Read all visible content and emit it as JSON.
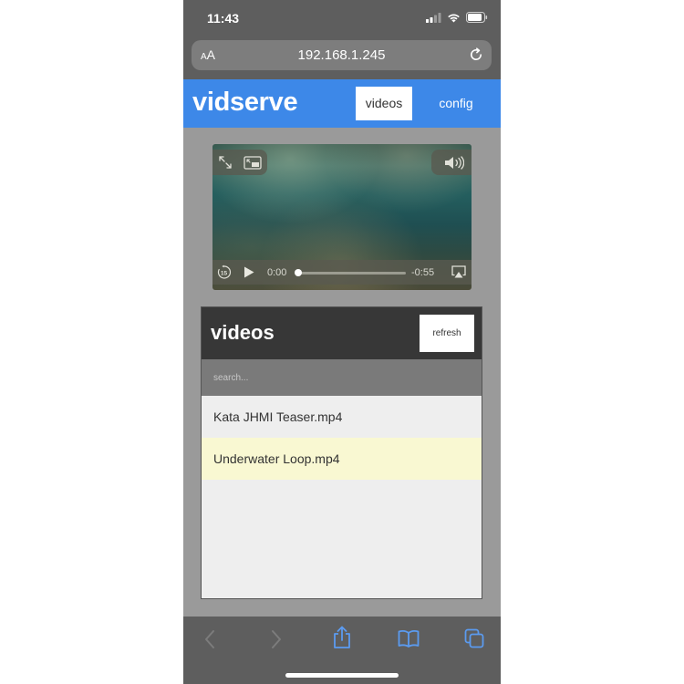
{
  "status_bar": {
    "time": "11:43"
  },
  "browser": {
    "text_size_label_small": "A",
    "text_size_label_large": "A",
    "url": "192.168.1.245"
  },
  "app": {
    "logo": "vidserve",
    "tabs": [
      {
        "label": "videos",
        "active": true
      },
      {
        "label": "config",
        "active": false
      }
    ],
    "accent_color": "#3d88e8"
  },
  "player": {
    "elapsed": "0:00",
    "remaining": "-0:55",
    "progress": 0.0
  },
  "videos_panel": {
    "title": "videos",
    "refresh_label": "refresh",
    "search_placeholder": "search...",
    "items": [
      {
        "name": "Kata JHMI Teaser.mp4",
        "selected": false
      },
      {
        "name": "Underwater Loop.mp4",
        "selected": true
      }
    ],
    "selected_color": "#f9f8d2"
  },
  "toolbar": {
    "icons": [
      "back-icon",
      "forward-icon",
      "share-icon",
      "bookmarks-icon",
      "tabs-icon"
    ]
  }
}
